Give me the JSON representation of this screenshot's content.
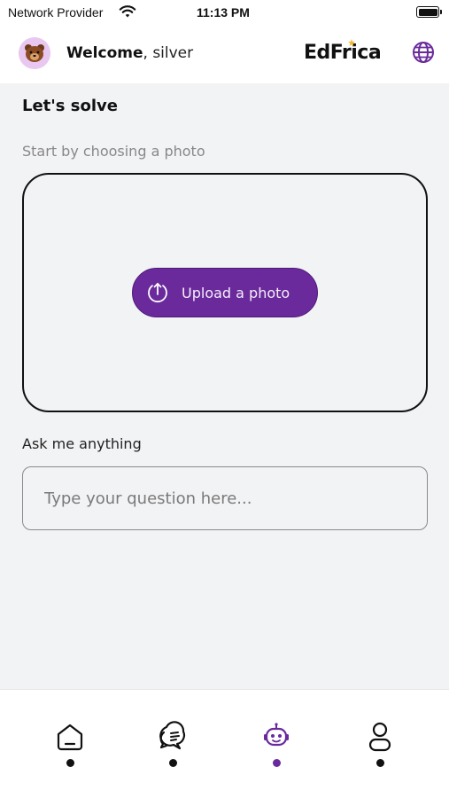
{
  "status_bar": {
    "carrier": "Network Provider",
    "time": "11:13 PM",
    "battery_level": 1.0
  },
  "header": {
    "welcome_bold": "Welcome",
    "welcome_rest": ", silver",
    "brand": "EdFrica",
    "icons": {
      "avatar": "bear-avatar",
      "language": "globe-icon"
    }
  },
  "main": {
    "title": "Let's solve",
    "photo_prompt": "Start by choosing a photo",
    "upload_label": "Upload a photo",
    "ask_label": "Ask me anything",
    "question_placeholder": "Type your question here..."
  },
  "bottom_nav": {
    "items": [
      {
        "icon": "home-icon",
        "active": false
      },
      {
        "icon": "chat-icon",
        "active": false
      },
      {
        "icon": "robot-icon",
        "active": true
      },
      {
        "icon": "profile-icon",
        "active": false
      }
    ]
  },
  "colors": {
    "accent": "#6a2a9c",
    "background": "#f2f3f5",
    "brand_star": "#f5b82e"
  }
}
